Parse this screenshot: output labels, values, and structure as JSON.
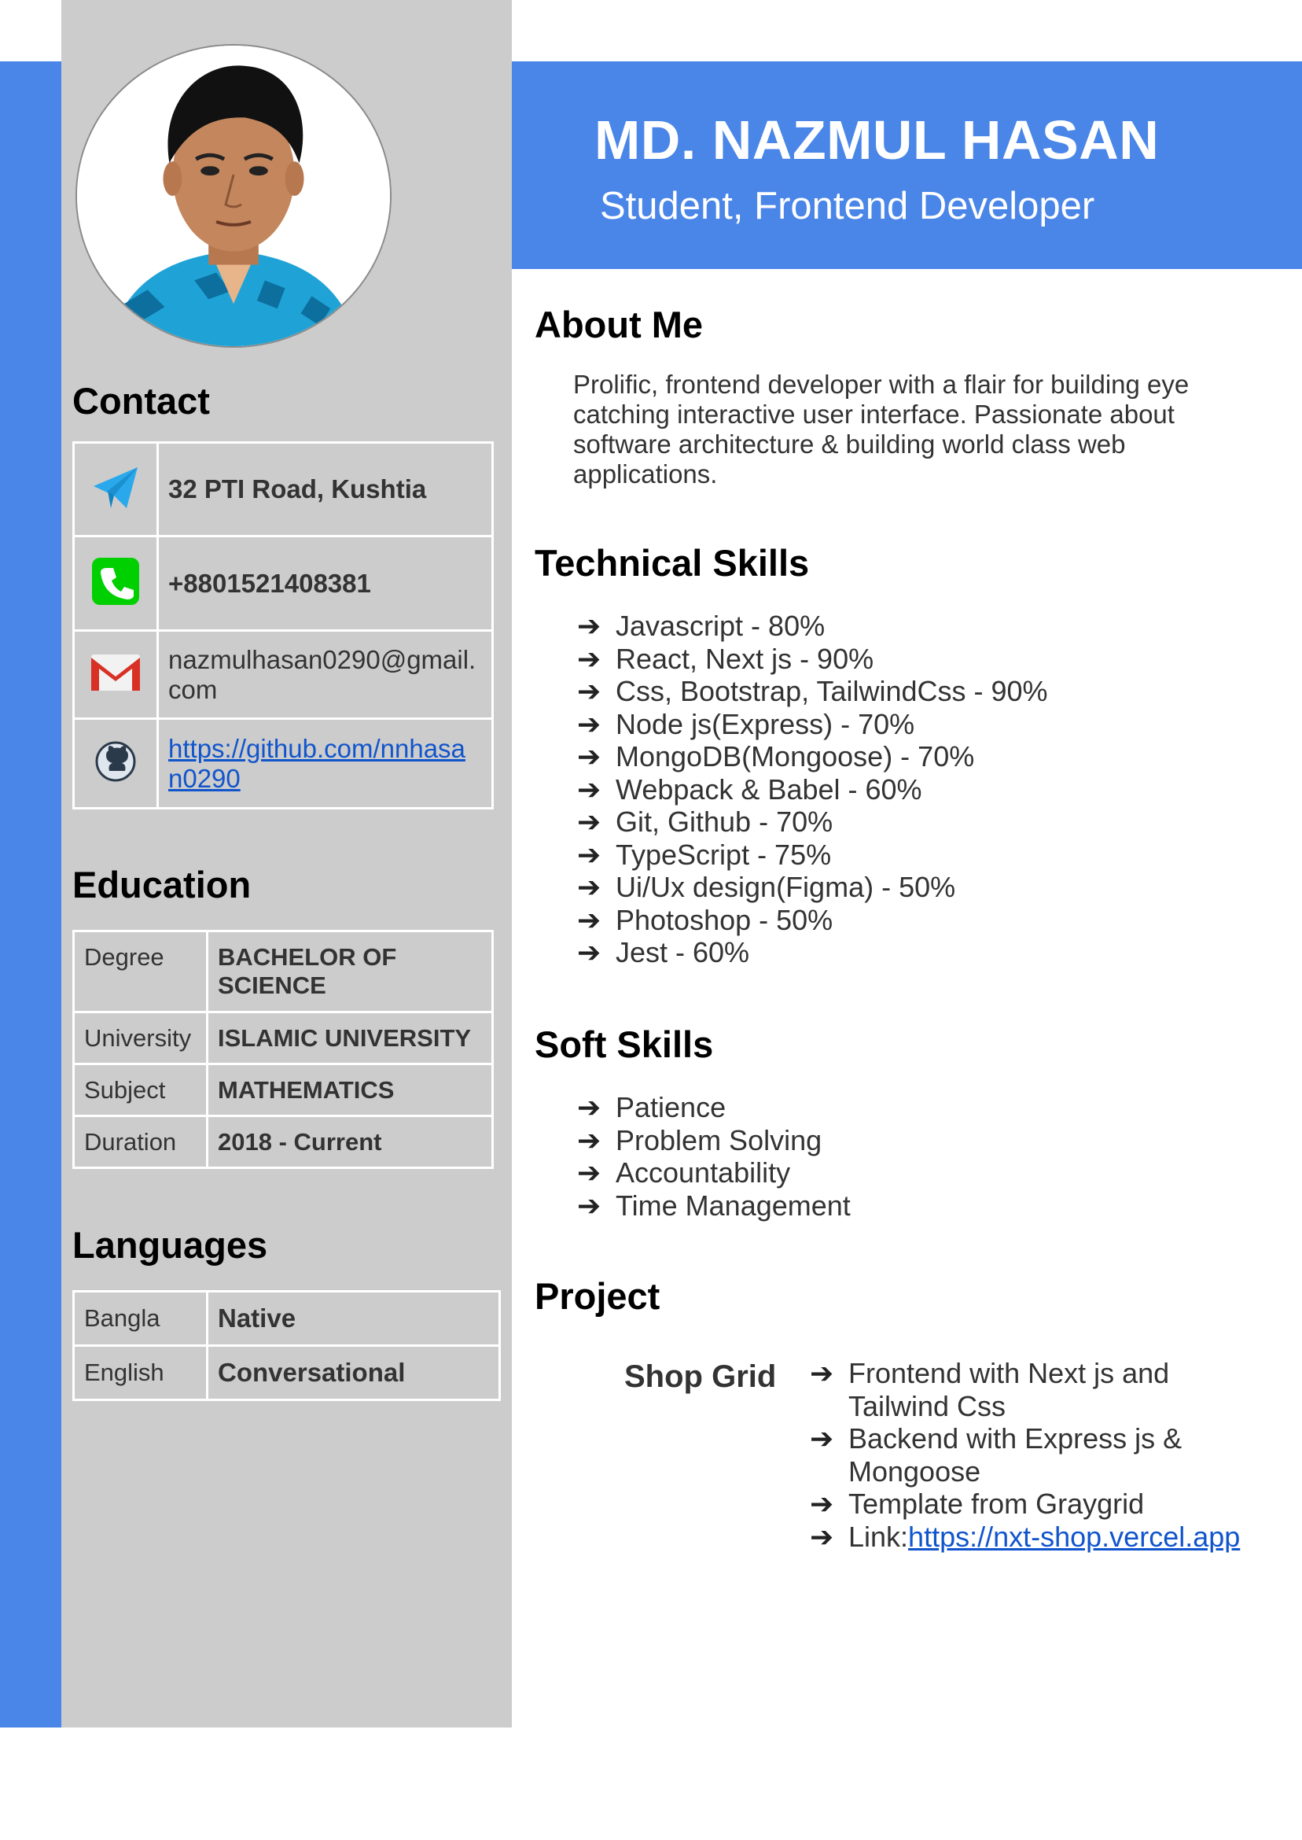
{
  "header": {
    "name": "MD. NAZMUL HASAN",
    "role": "Student, Frontend Developer"
  },
  "contact": {
    "title": "Contact",
    "items": [
      {
        "icon": "telegram-icon",
        "value": "32 PTI Road, Kushtia"
      },
      {
        "icon": "phone-icon",
        "value": "+8801521408381"
      },
      {
        "icon": "gmail-icon",
        "value_line1": "nazmulhasan0290@gmail.",
        "value_line2": "com"
      },
      {
        "icon": "github-icon",
        "value_line1": "https://github.com/nnhasa",
        "value_line2": "n0290"
      }
    ]
  },
  "education": {
    "title": "Education",
    "rows": [
      {
        "label": "Degree",
        "value": "BACHELOR OF SCIENCE"
      },
      {
        "label": "University",
        "value": "ISLAMIC UNIVERSITY"
      },
      {
        "label": "Subject",
        "value": "MATHEMATICS"
      },
      {
        "label": "Duration",
        "value": "2018 - Current"
      }
    ]
  },
  "languages": {
    "title": "Languages",
    "rows": [
      {
        "label": "Bangla",
        "value": "Native"
      },
      {
        "label": "English",
        "value": "Conversational"
      }
    ]
  },
  "about": {
    "title": "About Me",
    "text": "Prolific, frontend developer with a flair for building eye catching interactive user interface. Passionate about software architecture & building world class web applications."
  },
  "technical_skills": {
    "title": "Technical Skills",
    "items": [
      "Javascript - 80%",
      "React, Next js - 90%",
      "Css, Bootstrap, TailwindCss - 90%",
      "Node js(Express) - 70%",
      "MongoDB(Mongoose) - 70%",
      "Webpack & Babel - 60%",
      "Git, Github - 70%",
      "TypeScript - 75%",
      "Ui/Ux design(Figma) - 50%",
      "Photoshop - 50%",
      "Jest - 60%"
    ]
  },
  "soft_skills": {
    "title": "Soft Skills",
    "items": [
      "Patience",
      "Problem Solving",
      "Accountability",
      "Time Management"
    ]
  },
  "project": {
    "title": "Project",
    "name": "Shop Grid",
    "items": [
      "Frontend with Next js and Tailwind Css",
      "Backend with Express js & Mongoose",
      "Template from Graygrid"
    ],
    "link_prefix": "Link:",
    "link": "https://nxt-shop.vercel.app"
  },
  "arrow_glyph": "➔",
  "colors": {
    "accent": "#4a86e8",
    "sidebar": "#cccccc",
    "link": "#1155cc"
  }
}
